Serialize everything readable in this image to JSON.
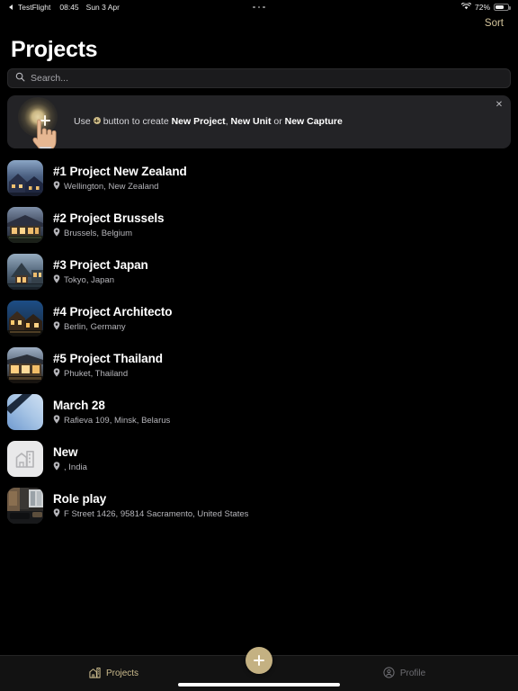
{
  "status_bar": {
    "back_app": "TestFlight",
    "time": "08:45",
    "date": "Sun 3 Apr",
    "battery_percent": "72%",
    "battery_level": 72,
    "wifi_icon": "wifi-icon",
    "more_icon": "ellipsis-icon"
  },
  "header": {
    "title": "Projects",
    "sort_label": "Sort"
  },
  "search": {
    "placeholder": "Search...",
    "value": "",
    "icon": "search-icon"
  },
  "banner": {
    "text_prefix": "Use",
    "text_middle": "button to create",
    "bold_1": "New Project",
    "separator_1": ", ",
    "bold_2": "New Unit",
    "separator_2": " or ",
    "bold_3": "New Capture",
    "close_icon": "close-icon",
    "plus_icon": "plus-icon",
    "hand_icon": "pointing-hand-icon"
  },
  "colors": {
    "accent": "#c4b182",
    "accent_text": "#d3c49b",
    "background": "#000000",
    "surface": "#232326",
    "search_surface": "#1b1b1d",
    "primary_text": "#ffffff",
    "secondary_text": "#b5b5ba",
    "tab_inactive": "#6d6d72"
  },
  "projects": [
    {
      "title": "#1 Project New Zealand",
      "location": "Wellington, New Zealand",
      "thumb": "house-dusk-blue"
    },
    {
      "title": "#2 Project Brussels",
      "location": "Brussels, Belgium",
      "thumb": "house-lit-warm"
    },
    {
      "title": "#3 Project Japan",
      "location": "Tokyo, Japan",
      "thumb": "house-gable-teal"
    },
    {
      "title": "#4 Project Architecto",
      "location": "Berlin, Germany",
      "thumb": "house-night-orange"
    },
    {
      "title": "#5 Project Thailand",
      "location": "Phuket, Thailand",
      "thumb": "house-modern-amber"
    },
    {
      "title": "March 28",
      "location": "Rafieva 109, Minsk, Belarus",
      "thumb": "sky-diagonal-blue"
    },
    {
      "title": "New",
      "location": ", India",
      "thumb": "placeholder-building"
    },
    {
      "title": "Role play",
      "location": "F Street 1426, 95814 Sacramento, United States",
      "thumb": "interior-room"
    }
  ],
  "tabbar": {
    "projects_label": "Projects",
    "projects_icon": "building-icon",
    "profile_label": "Profile",
    "profile_icon": "person-circle-icon",
    "fab_icon": "plus-icon"
  }
}
